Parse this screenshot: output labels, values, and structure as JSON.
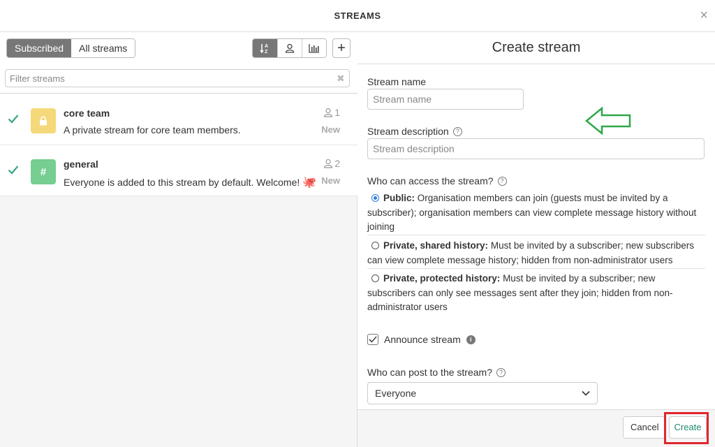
{
  "header": {
    "title": "STREAMS",
    "close_glyph": "×"
  },
  "left": {
    "tabs": [
      {
        "label": "Subscribed",
        "active": true
      },
      {
        "label": "All streams",
        "active": false
      }
    ],
    "sort_icons": [
      "sort-alpha-icon",
      "user-icon",
      "bar-chart-icon"
    ],
    "add_glyph": "+",
    "filter": {
      "placeholder": "Filter streams",
      "clear_glyph": "✖"
    },
    "streams": [
      {
        "name": "core team",
        "description": "A private stream for core team members.",
        "subscriber_count": "1",
        "status": "New",
        "color": "#f5d87a",
        "icon": "lock-icon",
        "emoji": ""
      },
      {
        "name": "general",
        "description": "Everyone is added to this stream by default. Welcome!",
        "subscriber_count": "2",
        "status": "New",
        "color": "#76ce90",
        "icon": "hash-icon",
        "icon_glyph": "#",
        "emoji": "🐙"
      }
    ]
  },
  "right": {
    "title": "Create stream",
    "stream_name": {
      "label": "Stream name",
      "placeholder": "Stream name"
    },
    "stream_description": {
      "label": "Stream description",
      "placeholder": "Stream description"
    },
    "access": {
      "label": "Who can access the stream?",
      "options": [
        {
          "title": "Public:",
          "text": "Organisation members can join (guests must be invited by a subscriber); organisation members can view complete message history without joining",
          "checked": true
        },
        {
          "title": "Private, shared history:",
          "text": "Must be invited by a subscriber; new subscribers can view complete message history; hidden from non-administrator users",
          "checked": false
        },
        {
          "title": "Private, protected history:",
          "text": "Must be invited by a subscriber; new subscribers can only see messages sent after they join; hidden from non-administrator users",
          "checked": false
        }
      ]
    },
    "announce": {
      "label": "Announce stream",
      "checked": true
    },
    "post_permission": {
      "label": "Who can post to the stream?",
      "selected": "Everyone"
    },
    "buttons": {
      "cancel": "Cancel",
      "create": "Create"
    }
  },
  "colors": {
    "accent_green": "#1e8a6e",
    "annotation_red": "#e0262d",
    "annotation_arrow": "#2ea84a",
    "radio_blue": "#2a7ddc"
  }
}
